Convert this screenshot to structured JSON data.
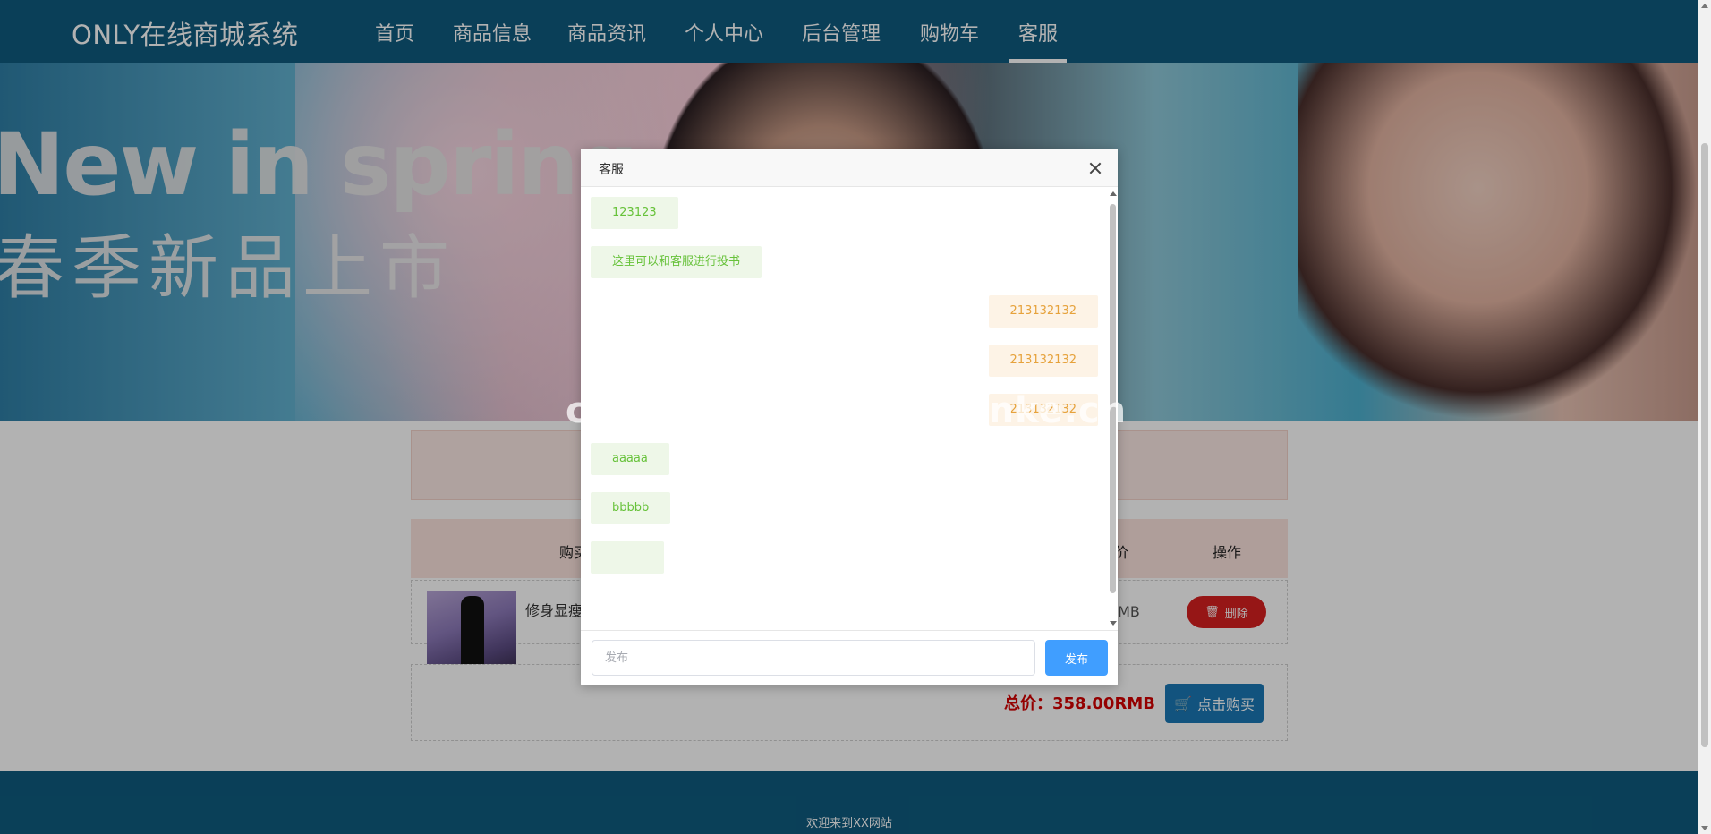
{
  "nav": {
    "brand": "ONLY在线商城系统",
    "items": [
      "首页",
      "商品信息",
      "商品资讯",
      "个人中心",
      "后台管理",
      "购物车",
      "客服"
    ],
    "active_index": 6
  },
  "banner": {
    "title_en": "New in spring",
    "title_cn": "春季新品上市"
  },
  "cart": {
    "header_buy": "购买",
    "header_price_fragment": "价",
    "header_action": "操作",
    "product_name": "修身显瘦",
    "price_fragment": "RMB",
    "delete_label": "删除",
    "total_label": "总价：358.00RMB",
    "buy_label": "点击购买"
  },
  "footer": {
    "text": "欢迎来到XX网站"
  },
  "dialog": {
    "title": "客服",
    "messages": [
      {
        "side": "left",
        "text": "123123"
      },
      {
        "side": "left",
        "text": "这里可以和客服进行投书"
      },
      {
        "side": "right",
        "text": "213132132"
      },
      {
        "side": "right",
        "text": "213132132"
      },
      {
        "side": "right",
        "text": "213132132"
      },
      {
        "side": "left",
        "text": "aaaaa"
      },
      {
        "side": "left",
        "text": "bbbbb"
      },
      {
        "side": "left",
        "text": ""
      }
    ],
    "input_placeholder": "发布",
    "send_label": "发布"
  },
  "watermark": "cn围观客www.weiguanke.cn",
  "colors": {
    "nav_bg": "#0f5b7e",
    "accent_blue": "#409eff",
    "msg_left_text": "#67c23a",
    "msg_right_text": "#e6a23c",
    "danger": "#d72020"
  }
}
